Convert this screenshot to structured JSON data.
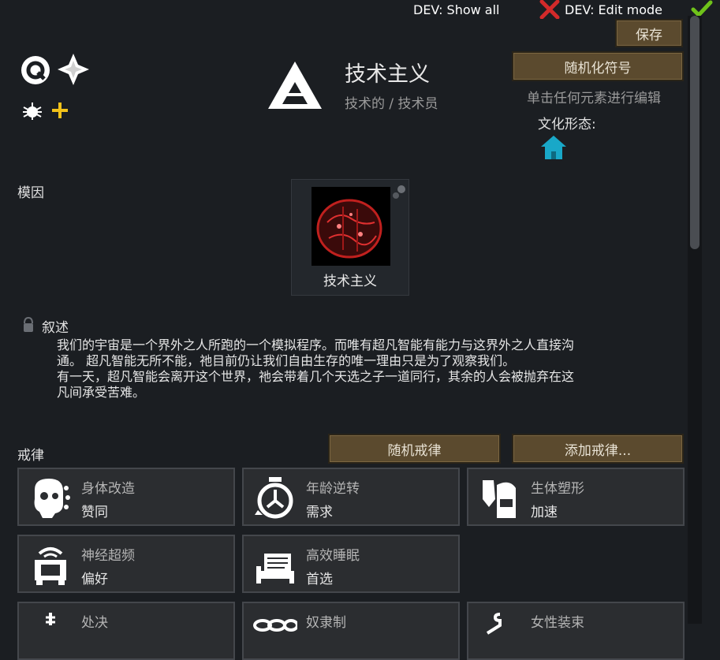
{
  "dev": {
    "show_all": "DEV: Show all",
    "edit_mode": "DEV: Edit mode"
  },
  "toolbar": {
    "save_label": "保存",
    "randomize_symbol_label": "随机化符号"
  },
  "ideo": {
    "title": "技术主义",
    "subtitle": "技术的 / 技术员",
    "edit_hint": "单击任何元素进行编辑",
    "culture_form_label": "文化形态:"
  },
  "memes": {
    "section_label": "模因",
    "items": [
      {
        "label": "技术主义"
      }
    ]
  },
  "narrative": {
    "section_label": "叙述",
    "lines": [
      "我们的宇宙是一个界外之人所跑的一个模拟程序。而唯有超凡智能有能力与这界外之人直接沟",
      "通。 超凡智能无所不能，祂目前仍让我们自由生存的唯一理由只是为了观察我们。",
      "有一天，超凡智能会离开这个世界，祂会带着几个天选之子一道同行，其余的人会被抛弃在这",
      "凡间承受苦难。"
    ]
  },
  "precepts": {
    "section_label": "戒律",
    "random_label": "随机戒律",
    "add_label": "添加戒律...",
    "items": [
      {
        "name": "身体改造",
        "value": "赞同"
      },
      {
        "name": "年龄逆转",
        "value": "需求"
      },
      {
        "name": "生体塑形",
        "value": "加速"
      },
      {
        "name": "神经超频",
        "value": "偏好"
      },
      {
        "name": "高效睡眠",
        "value": "首选"
      },
      {
        "name": "处决",
        "value": ""
      },
      {
        "name": "奴隶制",
        "value": ""
      },
      {
        "name": "女性装束",
        "value": ""
      }
    ]
  },
  "colors": {
    "background": "#1b1e22",
    "button": "#5b4a2e",
    "check": "#6fc21a",
    "cross": "#d22a2a",
    "culture_icon": "#19a8c8",
    "meme_red": "#c0201e",
    "symbol_yellow": "#f2c21a"
  }
}
